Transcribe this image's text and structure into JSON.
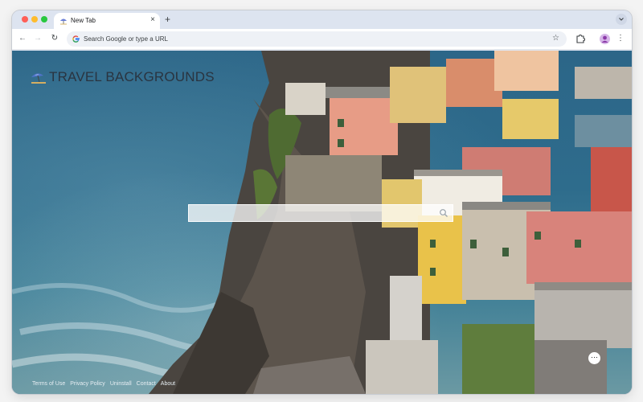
{
  "browser": {
    "tab": {
      "title": "New Tab",
      "close_glyph": "×"
    },
    "new_tab_glyph": "+",
    "tab_menu_glyph": "⌄",
    "nav": {
      "back_glyph": "←",
      "forward_glyph": "→",
      "reload_glyph": "↻"
    },
    "omnibox": {
      "placeholder": "Search Google or type a URL"
    },
    "star_glyph": "☆",
    "menu_glyph": "⋮"
  },
  "page": {
    "logo_text": "TRAVEL BACKGROUNDS",
    "search": {
      "value": ""
    },
    "footer_links": [
      "Terms of Use",
      "Privacy Policy",
      "Uninstall",
      "Contact",
      "About"
    ],
    "more_glyph": "⋯"
  },
  "colors": {
    "sea": "#2c6688",
    "window_chrome": "#dfe6f3",
    "traffic_red": "#ff5f57",
    "traffic_yellow": "#febc2e",
    "traffic_green": "#28c840"
  },
  "icons": {
    "tab_favicon": "travel-favicon-icon",
    "omnibox": "google-g-icon",
    "bookmark": "star-icon",
    "extensions": "puzzle-icon",
    "profile": "avatar-icon",
    "search": "search-icon",
    "logo": "beach-umbrella-icon"
  }
}
